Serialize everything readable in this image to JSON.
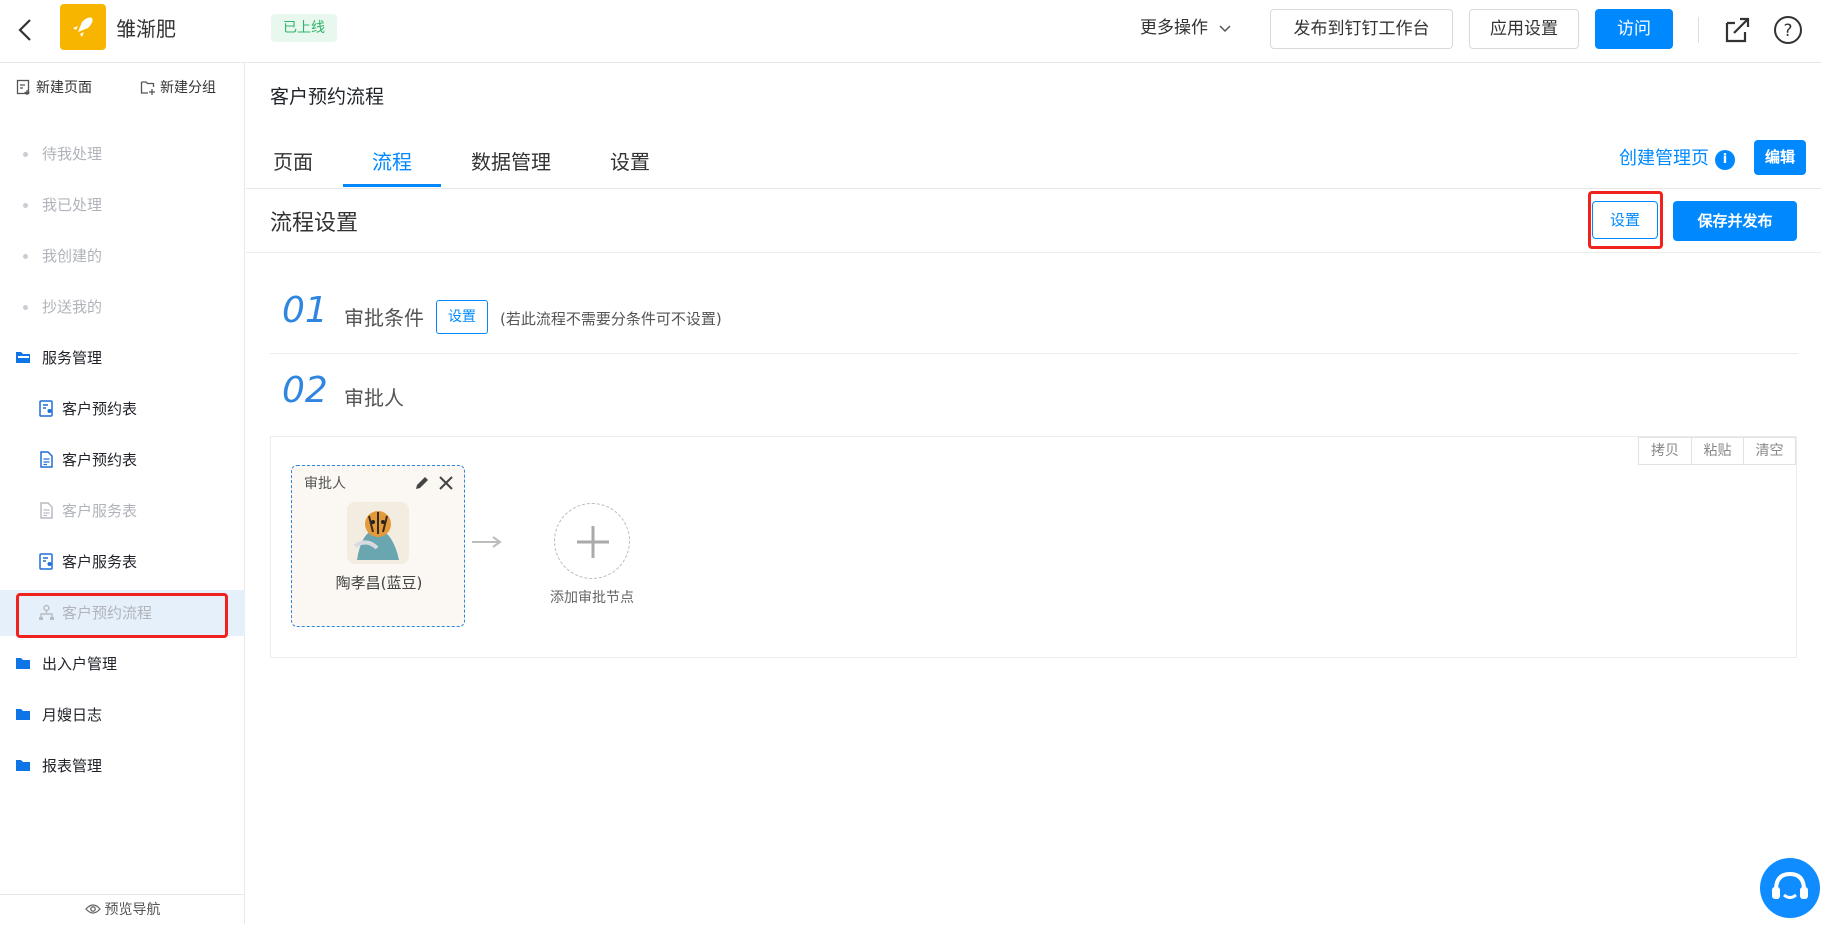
{
  "header": {
    "app_name": "雏渐肥",
    "status_tag": "已上线",
    "more_ops_label": "更多操作",
    "publish_label": "发布到钉钉工作台",
    "app_settings_label": "应用设置",
    "visit_label": "访问"
  },
  "sidebar": {
    "new_page": "新建页面",
    "new_group": "新建分组",
    "items": [
      {
        "label": "待我处理"
      },
      {
        "label": "我已处理"
      },
      {
        "label": "我创建的"
      },
      {
        "label": "抄送我的"
      },
      {
        "label": "服务管理"
      },
      {
        "label": "客户预约表"
      },
      {
        "label": "客户预约表"
      },
      {
        "label": "客户服务表"
      },
      {
        "label": "客户服务表"
      },
      {
        "label": "客户预约流程"
      },
      {
        "label": "出入户管理"
      },
      {
        "label": "月嫂日志"
      },
      {
        "label": "报表管理"
      }
    ],
    "preview_nav": "预览导航"
  },
  "main": {
    "page_title": "客户预约流程",
    "tabs": [
      {
        "label": "页面"
      },
      {
        "label": "流程"
      },
      {
        "label": "数据管理"
      },
      {
        "label": "设置"
      }
    ],
    "active_tab": "流程",
    "create_mgr_label": "创建管理页",
    "info_symbol": "i",
    "edit_label": "编辑",
    "flow_title": "流程设置",
    "settings_label": "设置",
    "save_publish_label": "保存并发布",
    "steps": [
      {
        "num": "01",
        "title": "审批条件",
        "button": "设置",
        "note": "(若此流程不需要分条件可不设置)"
      },
      {
        "num": "02",
        "title": "审批人"
      }
    ],
    "toolbar": [
      "拷贝",
      "粘贴",
      "清空"
    ],
    "node": {
      "label": "审批人",
      "approver_name": "陶孝昌(蓝豆)"
    },
    "add_node_label": "添加审批节点"
  },
  "colors": {
    "primary": "#0089ff",
    "highlight_red": "#f0221d",
    "status_green": "#2fb36a",
    "logo_yellow": "#f7b500"
  }
}
